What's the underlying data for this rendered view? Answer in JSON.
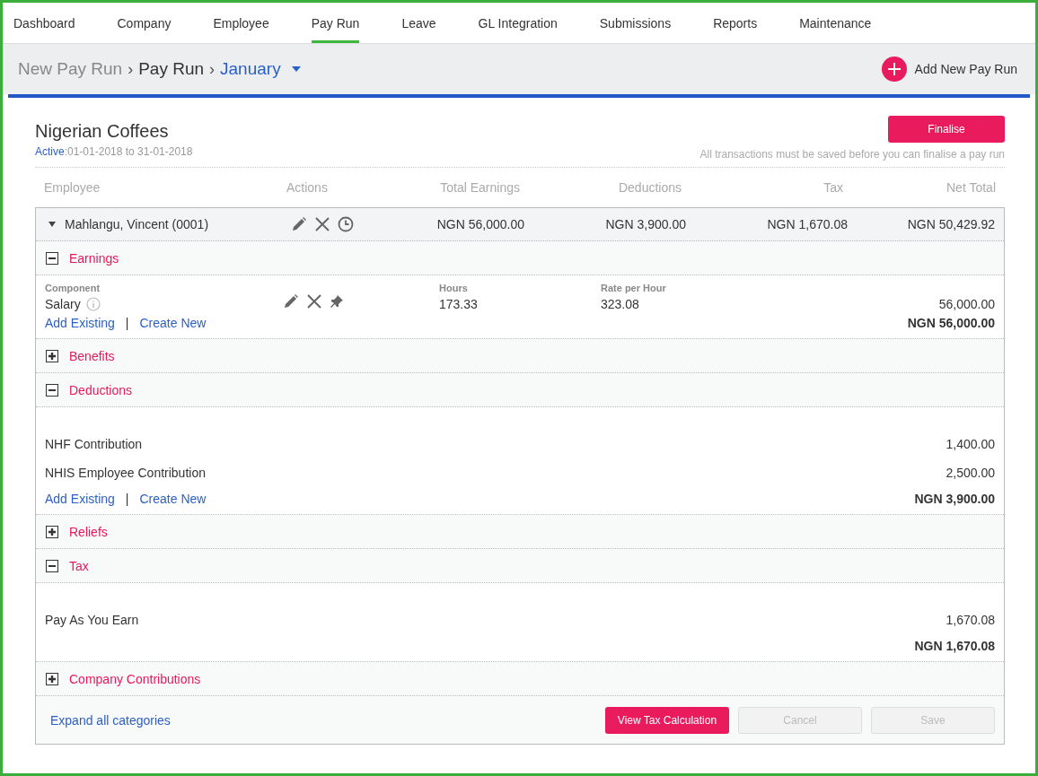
{
  "nav": [
    {
      "label": "Dashboard",
      "selected": false
    },
    {
      "label": "Company",
      "selected": false
    },
    {
      "label": "Employee",
      "selected": false
    },
    {
      "label": "Pay Run",
      "selected": true
    },
    {
      "label": "Leave",
      "selected": false
    },
    {
      "label": "GL Integration",
      "selected": false
    },
    {
      "label": "Submissions",
      "selected": false
    },
    {
      "label": "Reports",
      "selected": false
    },
    {
      "label": "Maintenance",
      "selected": false
    }
  ],
  "breadcrumb": {
    "separator": "›",
    "items": [
      {
        "label": "New Pay Run",
        "kind": "link"
      },
      {
        "label": "Pay Run",
        "kind": "current"
      },
      {
        "label": "January",
        "kind": "dropdown"
      }
    ]
  },
  "add_button": {
    "label": "Add New Pay Run"
  },
  "company": {
    "name": "Nigerian Coffees",
    "status": "Active",
    "period": ":01-01-2018 to 31-01-2018"
  },
  "finalise": {
    "label": "Finalise",
    "note": "All transactions must be saved before you can finalise a pay run"
  },
  "columns": [
    "Employee",
    "Actions",
    "Total Earnings",
    "Deductions",
    "Tax",
    "Net Total"
  ],
  "employee": {
    "name": "Mahlangu, Vincent (0001)",
    "expanded": true,
    "total_earnings": "NGN 56,000.00",
    "deductions": "NGN 3,900.00",
    "tax": "NGN 1,670.08",
    "net_total": "NGN 50,429.92"
  },
  "sections": [
    {
      "title": "Earnings",
      "expanded": true,
      "kind": "components",
      "headers": [
        "Component",
        "Hours",
        "Rate per Hour"
      ],
      "rows": [
        {
          "name": "Salary",
          "hours": "173.33",
          "rate": "323.08",
          "amount": "56,000.00"
        }
      ],
      "links": [
        "Add Existing",
        "Create New"
      ],
      "link_separator": "|",
      "total": "NGN 56,000.00"
    },
    {
      "title": "Benefits",
      "expanded": false
    },
    {
      "title": "Deductions",
      "expanded": true,
      "kind": "list",
      "rows": [
        {
          "name": "NHF Contribution",
          "amount": "1,400.00"
        },
        {
          "name": "NHIS Employee Contribution",
          "amount": "2,500.00"
        }
      ],
      "links": [
        "Add Existing",
        "Create New"
      ],
      "link_separator": "|",
      "total": "NGN 3,900.00"
    },
    {
      "title": "Reliefs",
      "expanded": false
    },
    {
      "title": "Tax",
      "expanded": true,
      "kind": "list",
      "rows": [
        {
          "name": "Pay As You Earn",
          "amount": "1,670.08"
        }
      ],
      "total": "NGN 1,670.08"
    },
    {
      "title": "Company Contributions",
      "expanded": false
    }
  ],
  "footer": {
    "expand_link": "Expand all categories",
    "buttons": [
      {
        "label": "View Tax Calculation",
        "disabled": false
      },
      {
        "label": "Cancel",
        "disabled": true
      },
      {
        "label": "Save",
        "disabled": true
      }
    ]
  }
}
